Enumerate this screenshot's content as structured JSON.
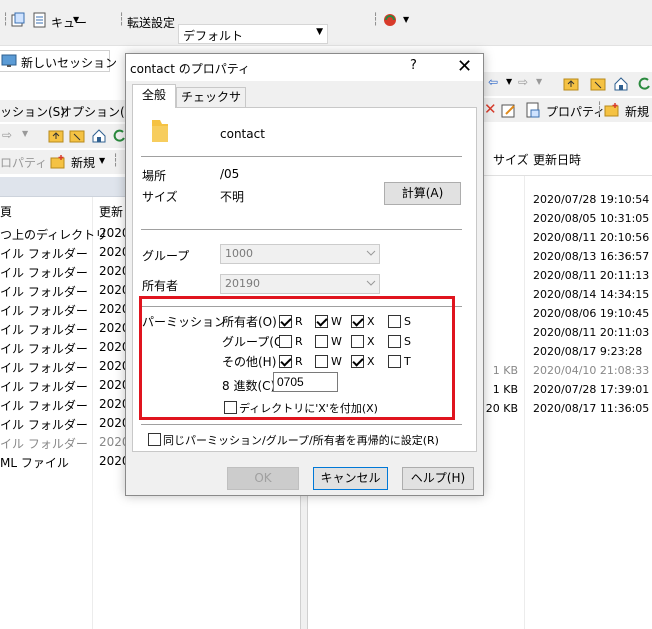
{
  "toolbar": {
    "queue_label": "キュー",
    "transfer_label": "転送設定",
    "transfer_value": "デフォルト"
  },
  "session_tab": {
    "label": "新しいセッション"
  },
  "left_panel": {
    "menu": [
      "ッション(S)",
      "オプション(O)"
    ],
    "toolbar_prop": "ロパティ",
    "toolbar_new": "新規",
    "header_name": "頁",
    "header_date": "更新",
    "rows": [
      {
        "name": "つ上のディレクトリ",
        "date": "2020/"
      },
      {
        "name": "イル フォルダー",
        "date": "2020/"
      },
      {
        "name": "イル フォルダー",
        "date": "2020/"
      },
      {
        "name": "イル フォルダー",
        "date": "2020/"
      },
      {
        "name": "イル フォルダー",
        "date": "2020/"
      },
      {
        "name": "イル フォルダー",
        "date": "2020/"
      },
      {
        "name": "イル フォルダー",
        "date": "2020/"
      },
      {
        "name": "イル フォルダー",
        "date": "2020/"
      },
      {
        "name": "イル フォルダー",
        "date": "2020/"
      },
      {
        "name": "イル フォルダー",
        "date": "2020/"
      },
      {
        "name": "イル フォルダー",
        "date": "2020/"
      },
      {
        "name": "イル フォルダー",
        "date": "2020/"
      },
      {
        "name": "ML ファイル",
        "date": "2020/"
      }
    ]
  },
  "right_panel": {
    "toolbar_prop": "プロパティ",
    "toolbar_new": "新規",
    "header_size": "サイズ",
    "header_date": "更新日時",
    "rows": [
      {
        "size": "",
        "date": "2020/07/28 19:10:54"
      },
      {
        "size": "",
        "date": "2020/08/05 10:31:05"
      },
      {
        "size": "",
        "date": "2020/08/11 20:10:56"
      },
      {
        "size": "",
        "date": "2020/08/13 16:36:57"
      },
      {
        "size": "",
        "date": "2020/08/11 20:11:13"
      },
      {
        "size": "",
        "date": "2020/08/14 14:34:15"
      },
      {
        "size": "",
        "date": "2020/08/06 19:10:45"
      },
      {
        "size": "",
        "date": "2020/08/11 20:11:03"
      },
      {
        "size": "",
        "date": "2020/08/17 9:23:28"
      },
      {
        "size": "1 KB",
        "date": "2020/04/10 21:08:33"
      },
      {
        "size": "1 KB",
        "date": "2020/07/28 17:39:01"
      },
      {
        "size": "20 KB",
        "date": "2020/08/17 11:36:05"
      }
    ]
  },
  "dialog": {
    "title": "contact のプロパティ",
    "help": "?",
    "close": "✕",
    "tabs": [
      "全般",
      "チェックサム"
    ],
    "file_name": "contact",
    "location_label": "場所",
    "location_value": "/05",
    "size_label": "サイズ",
    "size_value": "不明",
    "calc_button": "計算(A)",
    "group_label": "グループ",
    "group_value": "1000",
    "owner_label": "所有者",
    "owner_value": "20190",
    "permission_label": "パーミッション",
    "perm_owner": "所有者(O)",
    "perm_group": "グループ(G)",
    "perm_other": "その他(H)",
    "flags": {
      "r": "R",
      "w": "W",
      "x": "X",
      "s": "S",
      "t": "T"
    },
    "octal_label": "8 進数(C)",
    "octal_value": "0705",
    "add_x_label": "ディレクトリに'X'を付加(X)",
    "recursive_label": "同じパーミッション/グループ/所有者を再帰的に設定(R)",
    "ok": "OK",
    "cancel": "キャンセル",
    "help_btn": "ヘルプ(H)"
  },
  "colors": {
    "highlight": "#e0141e",
    "folder": "#f5c243",
    "accent": "#0078d7"
  }
}
